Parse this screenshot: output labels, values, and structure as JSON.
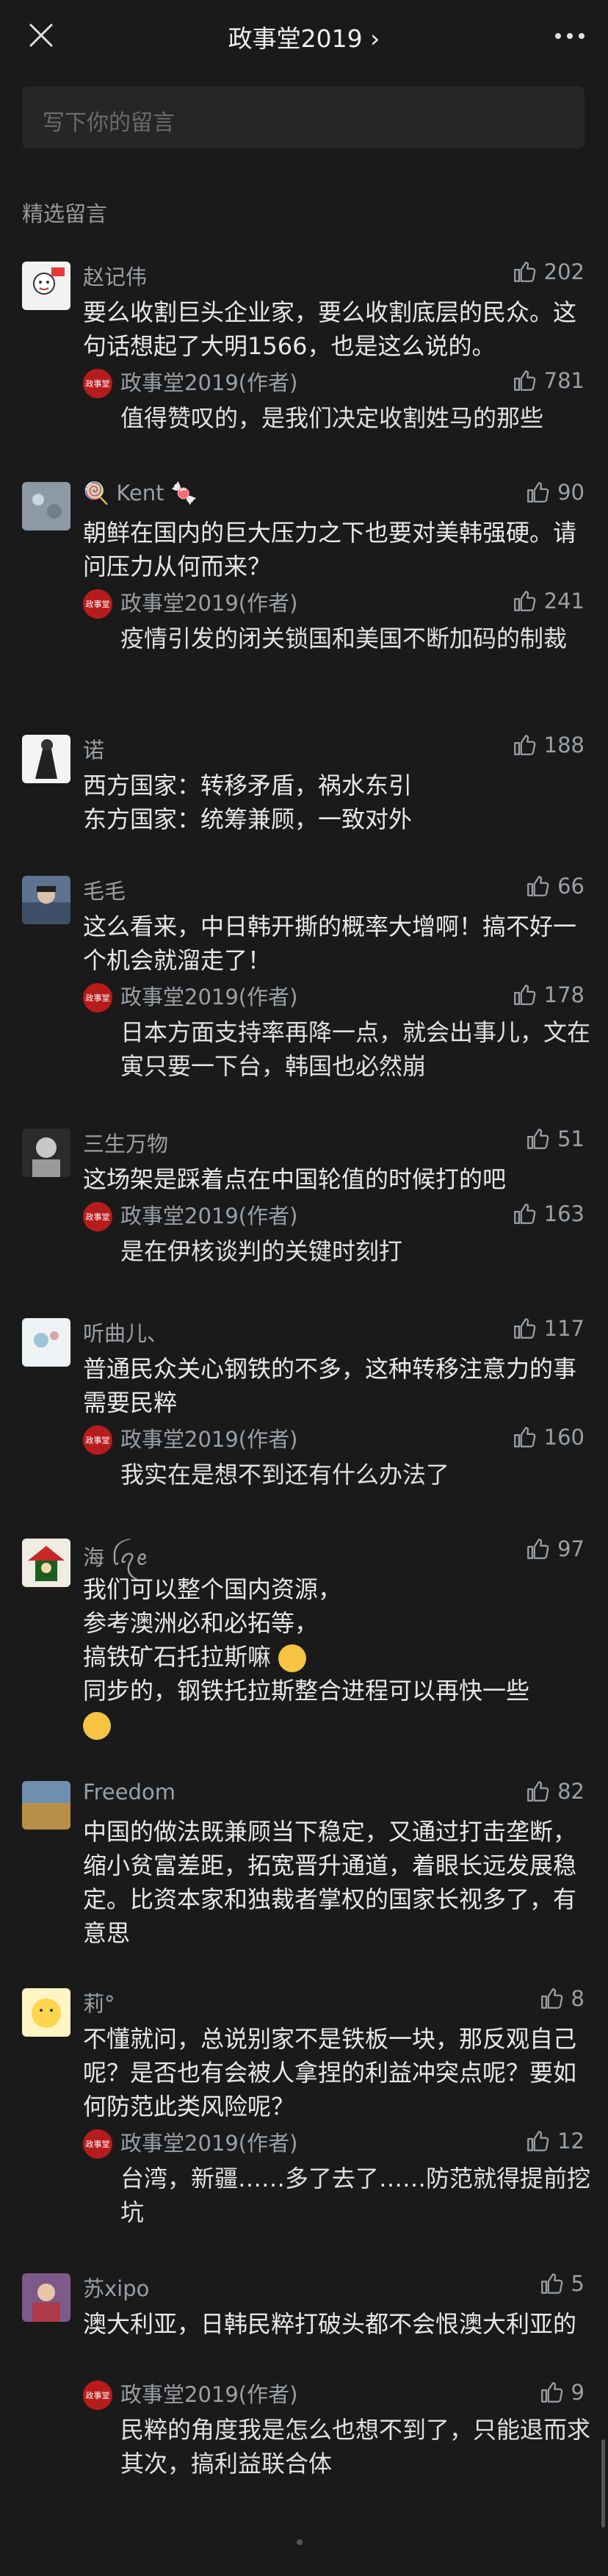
{
  "nav": {
    "title": "政事堂2019 ›"
  },
  "compose": {
    "placeholder": "写下你的留言"
  },
  "section_title": "精选留言",
  "author_reply_name": "政事堂2019(作者)",
  "author_avatar_text": "政事堂",
  "comments": [
    {
      "name": "赵记伟",
      "likes": "202",
      "text": "要么收割巨头企业家，要么收割底层的民众。这句话想起了大明1566，也是这么说的。",
      "reply": {
        "likes": "781",
        "text": "值得赞叹的，是我们决定收割姓马的那些"
      }
    },
    {
      "name": "🍭 Kent 🍬",
      "likes": "90",
      "text": "朝鲜在国内的巨大压力之下也要对美韩强硬。请问压力从何而来？",
      "reply": {
        "likes": "241",
        "text": "疫情引发的闭关锁国和美国不断加码的制裁"
      }
    },
    {
      "name": "诺",
      "likes": "188",
      "lines": [
        "西方国家：转移矛盾，祸水东引",
        "东方国家：统筹兼顾，一致对外"
      ]
    },
    {
      "name": "毛毛",
      "likes": "66",
      "text": "这么看来，中日韩开撕的概率大增啊！搞不好一个机会就溜走了！",
      "reply": {
        "likes": "178",
        "text": "日本方面支持率再降一点，就会出事儿，文在寅只要一下台，韩国也必然崩"
      }
    },
    {
      "name": "三生万物",
      "likes": "51",
      "text": "这场架是踩着点在中国轮值的时候打的吧",
      "reply": {
        "likes": "163",
        "text": "是在伊核谈判的关键时刻打"
      }
    },
    {
      "name": "听曲儿、",
      "likes": "117",
      "text": "普通民众关心钢铁的不多，这种转移注意力的事需要民粹",
      "reply": {
        "likes": "160",
        "text": "我实在是想不到还有什么办法了"
      }
    },
    {
      "name": "海 ꪶꪖꫀ",
      "likes": "97",
      "lines": [
        "我们可以整个国内资源，",
        "参考澳洲必和必拓等，",
        "搞铁矿石托拉斯嘛",
        "同步的，钢铁托拉斯整合进程可以再快一些"
      ]
    },
    {
      "name": "Freedom",
      "likes": "82",
      "text": "中国的做法既兼顾当下稳定，又通过打击垄断，缩小贫富差距，拓宽晋升通道，着眼长远发展稳定。比资本家和独裁者掌权的国家长视多了，有意思"
    },
    {
      "name": "莉°",
      "likes": "8",
      "text": "不懂就问，总说别家不是铁板一块，那反观自己呢？是否也有会被人拿捏的利益冲突点呢？要如何防范此类风险呢？",
      "reply": {
        "likes": "12",
        "text": "台湾，新疆……多了去了……防范就得提前挖坑"
      }
    },
    {
      "name": "苏xipo",
      "likes": "5",
      "text": "澳大利亚，日韩民粹打破头都不会恨澳大利亚的",
      "reply": {
        "likes": "9",
        "text": "民粹的角度我是怎么也想不到了，只能退而求其次，搞利益联合体"
      }
    }
  ],
  "colors": {
    "background": "#1a1a1a",
    "text": "#e8e8e8",
    "secondary": "#9aa0a6",
    "author_badge": "#b71c1c"
  },
  "icons": [
    "close-icon",
    "more-icon",
    "thumb-up-icon"
  ]
}
